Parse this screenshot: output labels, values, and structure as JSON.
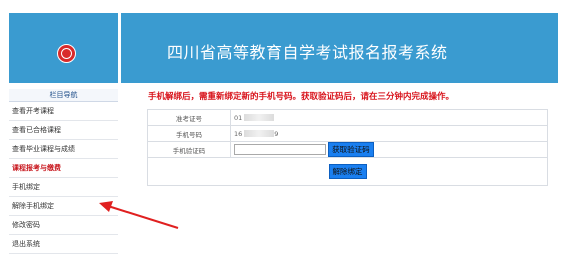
{
  "header": {
    "title": "四川省高等教育自学考试报名报考系统",
    "logo_icon": "emblem-icon",
    "brand_color": "#3a9bd0"
  },
  "sidebar": {
    "heading": "栏目导航",
    "items": [
      {
        "label": "查看开考课程"
      },
      {
        "label": "查看已合格课程"
      },
      {
        "label": "查看毕业课程与成绩"
      },
      {
        "label": "课程报考与缴费"
      },
      {
        "label": "手机绑定"
      },
      {
        "label": "解除手机绑定"
      },
      {
        "label": "修改密码"
      },
      {
        "label": "退出系统"
      }
    ]
  },
  "notice": "手机解绑后，需重新绑定新的手机号码。获取验证码后，请在三分钟内完成操作。",
  "form": {
    "exam_id_label": "准考证号",
    "exam_id_value": "01",
    "phone_label": "手机号码",
    "phone_value": "16",
    "phone_value_suffix": "9",
    "code_label": "手机验证码",
    "code_value": "",
    "get_code_button": "获取验证码",
    "unbind_button": "解除绑定"
  },
  "annotation_color": "#e02020"
}
